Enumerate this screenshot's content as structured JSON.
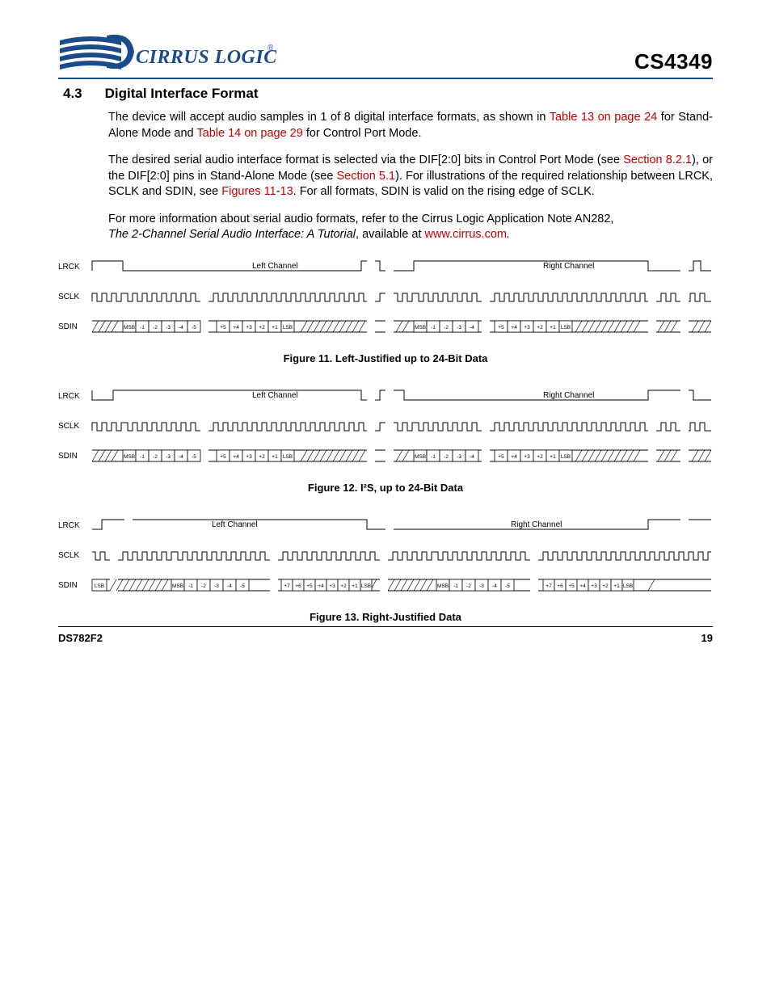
{
  "header": {
    "logo_text": "CIRRUS LOGIC",
    "logo_reg": "®",
    "part_number": "CS4349"
  },
  "section": {
    "number": "4.3",
    "title": "Digital Interface Format"
  },
  "paragraphs": {
    "p1a": "The device will accept audio samples in 1 of 8 digital interface formats, as shown in ",
    "p1_link1": "Table 13 on page 24",
    "p1b": " for Stand-Alone Mode and ",
    "p1_link2": "Table 14 on page 29",
    "p1c": " for Control Port Mode.",
    "p2a": "The desired serial audio interface format is selected via the DIF[2:0] bits in Control Port Mode (see ",
    "p2_link1": "Section 8.2.1",
    "p2b": "), or the DIF[2:0] pins in Stand-Alone Mode (see ",
    "p2_link2": "Section 5.1",
    "p2c": "). For illustrations of the required relationship between LRCK, SCLK and SDIN, see ",
    "p2_link3": "Figures 11",
    "p2d": "-",
    "p2_link4": "13",
    "p2e": ". For all formats, SDIN is valid on the rising edge of SCLK.",
    "p3a": "For more information about serial audio formats, refer to the Cirrus Logic Application Note AN282, ",
    "p3_italic": "The 2-Channel Serial Audio Interface: A Tutorial",
    "p3b": ", available at ",
    "p3_link1": "www.cirrus.com",
    "p3c": "."
  },
  "signals": {
    "lrck": "LRCK",
    "sclk": "SCLK",
    "sdin": "SDIN",
    "left": "Left Channel",
    "right": "Right Channel",
    "msb": "MSB",
    "lsb": "LSB"
  },
  "chart_data": [
    {
      "type": "timing",
      "caption": "Figure 11.  Left-Justified up to 24-Bit Data",
      "signals": [
        "LRCK",
        "SCLK",
        "SDIN"
      ],
      "lrck": {
        "pattern": "low-then-high-per-channel",
        "channels": [
          "Left Channel",
          "Right Channel"
        ]
      },
      "sdin_bits_left_head": [
        "MSB",
        "-1",
        "-2",
        "-3",
        "-4",
        "-5"
      ],
      "sdin_bits_left_tail": [
        "+5",
        "+4",
        "+3",
        "+2",
        "+1",
        "LSB"
      ],
      "sdin_bits_right_head": [
        "MSB",
        "-1",
        "-2",
        "-3",
        "-4"
      ],
      "sdin_bits_right_tail": [
        "+5",
        "+4",
        "+3",
        "+2",
        "+1",
        "LSB"
      ]
    },
    {
      "type": "timing",
      "caption": "Figure 12.  I²S, up to 24-Bit Data",
      "signals": [
        "LRCK",
        "SCLK",
        "SDIN"
      ],
      "lrck": {
        "pattern": "low-then-high-per-channel-delayed-1bit",
        "channels": [
          "Left Channel",
          "Right Channel"
        ]
      },
      "sdin_bits_left_head": [
        "MSB",
        "-1",
        "-2",
        "-3",
        "-4",
        "-5"
      ],
      "sdin_bits_left_tail": [
        "+5",
        "+4",
        "+3",
        "+2",
        "+1",
        "LSB"
      ],
      "sdin_bits_right_head": [
        "MSB",
        "-1",
        "-2",
        "-3",
        "-4"
      ],
      "sdin_bits_right_tail": [
        "+5",
        "+4",
        "+3",
        "+2",
        "+1",
        "LSB"
      ]
    },
    {
      "type": "timing",
      "caption": "Figure 13.  Right-Justified Data",
      "signals": [
        "LRCK",
        "SCLK",
        "SDIN"
      ],
      "lrck": {
        "pattern": "high-then-low-per-channel",
        "channels": [
          "Left Channel",
          "Right Channel"
        ]
      },
      "sdin_bits_left_head": [
        "LSB",
        "MSB",
        "-1",
        "-2",
        "-3",
        "-4",
        "-5"
      ],
      "sdin_bits_left_tail": [
        "+7",
        "+6",
        "+5",
        "+4",
        "+3",
        "+2",
        "+1",
        "LSB"
      ],
      "sdin_bits_right_head": [
        "MSB",
        "-1",
        "-2",
        "-3",
        "-4",
        "-5"
      ],
      "sdin_bits_right_tail": [
        "+7",
        "+6",
        "+5",
        "+4",
        "+3",
        "+2",
        "+1",
        "LSB"
      ]
    }
  ],
  "footer": {
    "doc_id": "DS782F2",
    "page_num": "19"
  }
}
